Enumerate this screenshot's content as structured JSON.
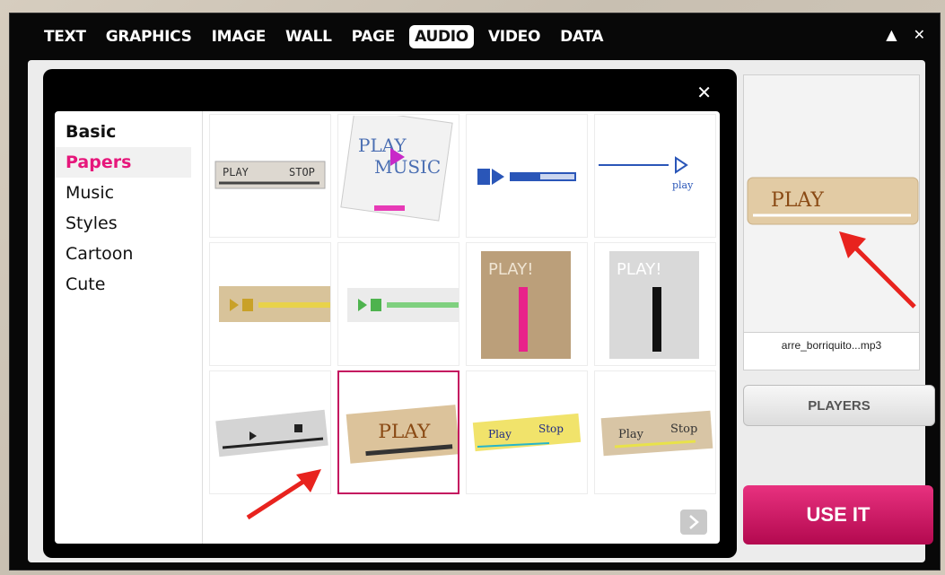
{
  "tabs": [
    {
      "label": "TEXT"
    },
    {
      "label": "GRAPHICS"
    },
    {
      "label": "IMAGE"
    },
    {
      "label": "WALL"
    },
    {
      "label": "PAGE"
    },
    {
      "label": "AUDIO",
      "active": true
    },
    {
      "label": "VIDEO"
    },
    {
      "label": "DATA"
    }
  ],
  "window_controls": {
    "collapse": "▲",
    "close": "✕"
  },
  "panel": {
    "close": "✕"
  },
  "categories": [
    {
      "label": "Basic"
    },
    {
      "label": "Papers",
      "selected": true
    },
    {
      "label": "Music"
    },
    {
      "label": "Styles"
    },
    {
      "label": "Cartoon"
    },
    {
      "label": "Cute"
    }
  ],
  "tiles": [
    {
      "label_a": "PLAY",
      "label_b": "STOP"
    },
    {
      "label_a": "PLAY",
      "label_b": "MUSIC"
    },
    {
      "label_a": "",
      "label_b": ""
    },
    {
      "label_a": "play",
      "label_b": ""
    },
    {
      "label_a": "",
      "label_b": ""
    },
    {
      "label_a": "",
      "label_b": ""
    },
    {
      "label_a": "PLAY!",
      "label_b": ""
    },
    {
      "label_a": "PLAY!",
      "label_b": ""
    },
    {
      "label_a": "",
      "label_b": ""
    },
    {
      "label_a": "PLAY",
      "label_b": "",
      "selected": true
    },
    {
      "label_a": "Play",
      "label_b": "Stop"
    },
    {
      "label_a": "Play",
      "label_b": "Stop"
    }
  ],
  "preview": {
    "label": "PLAY",
    "filename": "arre_borriquito...mp3"
  },
  "buttons": {
    "players": "PLAYERS",
    "use_it": "USE IT"
  },
  "colors": {
    "accent_pink": "#e6177b",
    "use_it_bg": "#c81563",
    "annotation_red": "#e8231e"
  }
}
